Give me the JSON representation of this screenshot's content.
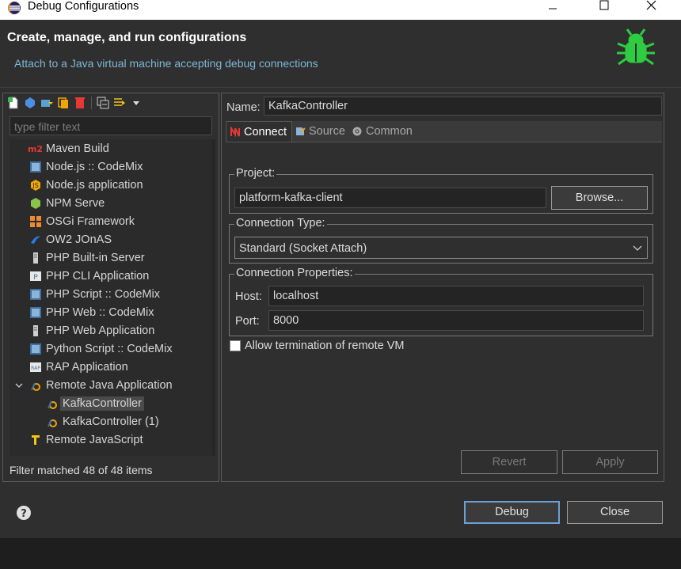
{
  "window": {
    "title": "Debug Configurations"
  },
  "header": {
    "title": "Create, manage, and run configurations",
    "subtitle": "Attach to a Java virtual machine accepting debug connections"
  },
  "left": {
    "filter_placeholder": "type filter text",
    "toolbar_icons": [
      "new-configuration-icon",
      "new-prototype-icon",
      "export-icon",
      "duplicate-icon",
      "delete-icon",
      "collapse-all-icon",
      "filter-icon",
      "view-menu-icon"
    ],
    "tree": [
      {
        "label": "Maven Build",
        "icon": "maven-icon"
      },
      {
        "label": "Node.js :: CodeMix",
        "icon": "codemix-icon"
      },
      {
        "label": "Node.js application",
        "icon": "nodejs-icon"
      },
      {
        "label": "NPM Serve",
        "icon": "npm-icon"
      },
      {
        "label": "OSGi Framework",
        "icon": "osgi-icon"
      },
      {
        "label": "OW2 JOnAS",
        "icon": "jonas-icon"
      },
      {
        "label": "PHP Built-in Server",
        "icon": "php-server-icon"
      },
      {
        "label": "PHP CLI Application",
        "icon": "php-cli-icon"
      },
      {
        "label": "PHP Script :: CodeMix",
        "icon": "codemix-icon"
      },
      {
        "label": "PHP Web :: CodeMix",
        "icon": "codemix-icon"
      },
      {
        "label": "PHP Web Application",
        "icon": "php-web-icon"
      },
      {
        "label": "Python Script :: CodeMix",
        "icon": "codemix-icon"
      },
      {
        "label": "RAP Application",
        "icon": "rap-icon"
      },
      {
        "label": "Remote Java Application",
        "icon": "remote-java-icon",
        "expanded": true
      },
      {
        "label": "KafkaController",
        "icon": "remote-java-icon",
        "child": true,
        "selected": true
      },
      {
        "label": "KafkaController (1)",
        "icon": "remote-java-icon",
        "child": true
      },
      {
        "label": "Remote JavaScript",
        "icon": "remote-js-icon"
      }
    ],
    "status": "Filter matched 48 of 48 items"
  },
  "right": {
    "name_label": "Name:",
    "name_value": "KafkaController",
    "tabs": [
      {
        "label": "Connect",
        "icon": "connect-icon",
        "active": true
      },
      {
        "label": "Source",
        "icon": "source-icon"
      },
      {
        "label": "Common",
        "icon": "common-icon"
      }
    ],
    "project": {
      "label": "Project:",
      "value": "platform-kafka-client",
      "browse_label": "Browse..."
    },
    "connection_type": {
      "label": "Connection Type:",
      "value": "Standard (Socket Attach)"
    },
    "connection_properties": {
      "label": "Connection Properties:",
      "host_label": "Host:",
      "host_value": "localhost",
      "port_label": "Port:",
      "port_value": "8000"
    },
    "allow_termination_label": "Allow termination of remote VM",
    "revert_label": "Revert",
    "apply_label": "Apply"
  },
  "footer": {
    "debug_label": "Debug",
    "close_label": "Close"
  },
  "colors": {
    "accent_link": "#7fb6d6",
    "bug_green": "#2ecc40",
    "focus_border": "#6aa0d8"
  }
}
